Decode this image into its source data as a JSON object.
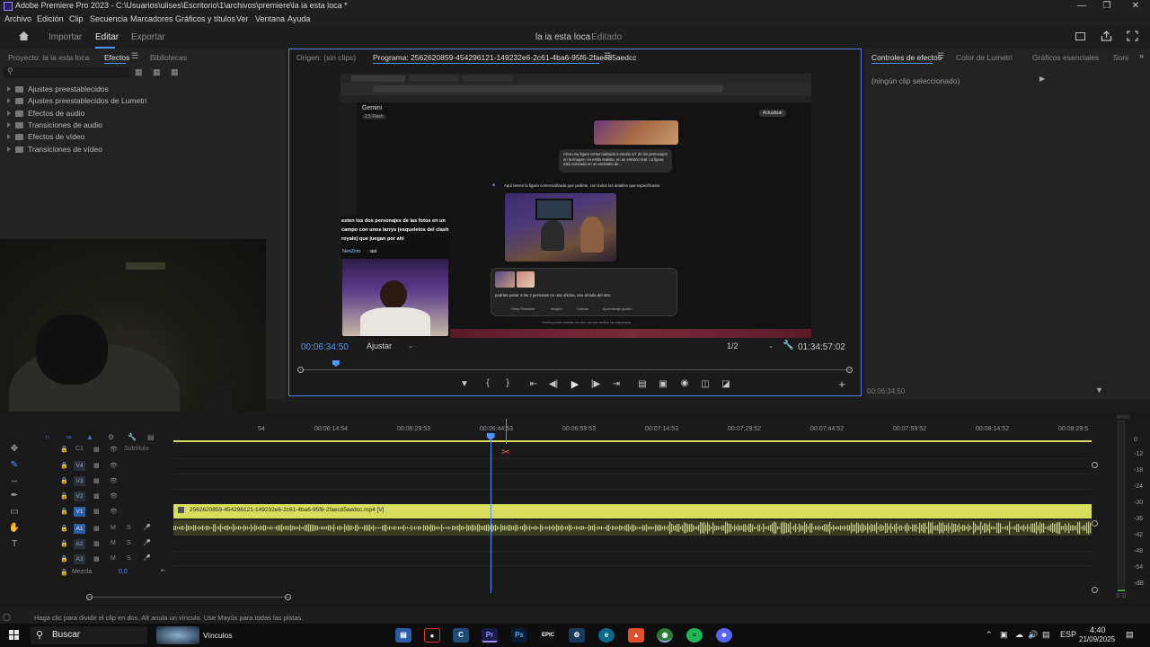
{
  "window": {
    "title": "Adobe Premiere Pro 2023 - C:\\Usuarios\\ulises\\Escritorio\\1\\archivos\\premiere\\la ia esta loca *"
  },
  "menu": [
    "Archivo",
    "Edición",
    "Clip",
    "Secuencia",
    "Marcadores",
    "Gráficos y títulos",
    "Ver",
    "Ventana",
    "Ayuda"
  ],
  "workspace": {
    "tabs": [
      "Importar",
      "Editar",
      "Exportar"
    ],
    "active_tab": "Editar",
    "project_title": "la ia esta loca",
    "project_status": "- Editado"
  },
  "left_panel": {
    "tabs": [
      "Proyecto: la ia esta loca",
      "Efectos",
      "Bibliotecas"
    ],
    "active_tab": "Efectos",
    "search_placeholder": "",
    "items": [
      "Ajustes preestablecidos",
      "Ajustes preestablecidos de Lumetri",
      "Efectos de audio",
      "Transiciones de audio",
      "Efectos de vídeo",
      "Transiciones de vídeo"
    ]
  },
  "program": {
    "tabs": [
      "Origen: (sin clips)",
      "Programa: 2562620859-454296121-149232e6-2c61-4ba6-95f6-2faecd5aedcc"
    ],
    "current_tc": "00:06:34:50",
    "fit": "Ajustar",
    "resolution": "1/2",
    "duration_tc": "01:34:57:02",
    "playhead_fraction": 0.065
  },
  "video_content": {
    "app_name": "Gemini",
    "app_version": "2.5 Flash",
    "prompt1": "Crea una figura comercializada a escala 1/7 de los personajes en la imagen, en estilo realista, en un entorno real. La figura está colocada en un escritorio de...",
    "response_text": "Aquí tienes la figura comercializada que pediste, con todos los detalles que especificaste:",
    "chat_overlay_text": "esten los dos personajes de las fotos en un campo con unos larrys (esqueletos del clash royale) que juegan por ahi",
    "chat_user": "NexZiim",
    "chat_user_msg": ": asi",
    "prompt2": "podrias juntar a las 2 personas en una oficina, uno al lado del otro",
    "tools": [
      "Deep Research",
      "Imagen",
      "Canvas",
      "Aprendizaje guiado"
    ],
    "disclaimer": "Gemini puede cometer errores, así que verifica las respuestas.",
    "update_btn": "Actualizar"
  },
  "right_panel": {
    "tabs": [
      "Controles de efectos",
      "Color de Lumetri",
      "Gráficos esenciales",
      "Soni"
    ],
    "active_tab": "Controles de efectos",
    "no_clip": "(ningún clip seleccionado)",
    "bottom_tc": "00:06:34:50"
  },
  "timeline": {
    "ruler_labels": [
      "54",
      "00:06:14:54",
      "00:06:29:53",
      "00:06:44:53",
      "00:06:59:53",
      "00:07:14:53",
      "00:07:29:52",
      "00:07:44:52",
      "00:07:59:52",
      "00:08:14:52",
      "00:08:29:5"
    ],
    "playhead_fraction": 0.345,
    "subtitle_label": "Subtítulo",
    "subtitle_track": "C1",
    "video_tracks": [
      "V4",
      "V3",
      "V2",
      "V1"
    ],
    "audio_tracks": [
      "A1",
      "A2",
      "A3"
    ],
    "audio_btns": [
      "M",
      "S"
    ],
    "mix_label": "Mezcla",
    "mix_value": "0,0",
    "clip_name": "2562620859-454296121-149232e6-2c61-4ba6-95f6-2faecd5aedcc.mp4 [V]",
    "meter_labels": [
      "0",
      "-6",
      "-12",
      "-18",
      "-24",
      "-30",
      "-36",
      "-42",
      "-48",
      "-54",
      "-dB"
    ],
    "meter_footer": "S S"
  },
  "status_text": "Haga clic para dividir el clip en dos. Alt anula un vínculo. Use Mayús para todas las pistas.",
  "taskbar": {
    "search_label": "Buscar",
    "widget_label": "Vínculos",
    "lang": "ESP",
    "time": "4:40",
    "date": "21/09/2025"
  },
  "colors": {
    "accent_blue": "#4d96ff",
    "clip_yellow": "#d9dd5e",
    "audio_green": "#9aa23a",
    "panel_bg": "#232323"
  }
}
